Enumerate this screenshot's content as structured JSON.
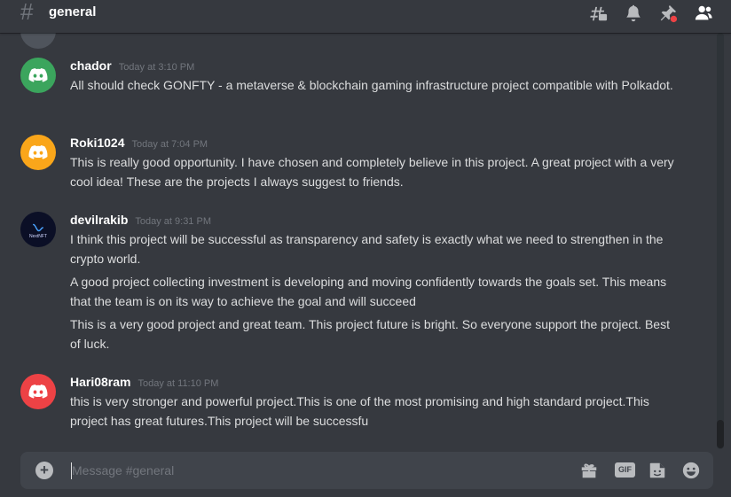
{
  "channel": {
    "hash": "#",
    "name": "general"
  },
  "header_icons": [
    "threads-icon",
    "bell-icon",
    "pin-icon",
    "member-list-icon"
  ],
  "colors": {
    "background": "#36393f",
    "composer": "#40444b",
    "unread_dot": "#ed4245"
  },
  "messages": [
    {
      "username": "chador",
      "timestamp": "Today at 3:10 PM",
      "avatar_color": "#3ba55d",
      "avatar_icon": "discord-logo-icon",
      "lines": [
        "All should check GONFTY - a metaverse & blockchain gaming infrastructure project compatible with Polkadot."
      ]
    },
    {
      "username": "Roki1024",
      "timestamp": "Today at 7:04 PM",
      "avatar_color": "#faa61a",
      "avatar_icon": "discord-logo-icon",
      "lines": [
        "This is really good opportunity. I have chosen and completely believe in this project. A great project with a very cool idea! These are the projects I always suggest to friends."
      ]
    },
    {
      "username": "devilrakib",
      "timestamp": "Today at 9:31 PM",
      "avatar_color": "#0b0f26",
      "avatar_icon": "nextnft-logo-icon",
      "avatar_text": "NextNFT",
      "lines": [
        "I think this project will be successful as transparency and safety is exactly what we need to strengthen in the crypto world.",
        "A good project collecting investment is developing and moving confidently towards the goals set. This means that the team is on its way to achieve the goal and will succeed",
        "This is a very good project and great team. This project future is bright. So everyone support the project. Best of luck."
      ]
    },
    {
      "username": "Hari08ram",
      "timestamp": "Today at 11:10 PM",
      "avatar_color": "#ed4245",
      "avatar_icon": "discord-logo-icon",
      "lines": [
        "this is very stronger and powerful project.This is one of the most promising and high standard project.This project has great futures.This project will be successfu"
      ]
    }
  ],
  "composer": {
    "placeholder": "Message #general",
    "gif_label": "GIF",
    "icons": [
      "add-attachment-icon",
      "gift-icon",
      "gif-icon",
      "sticker-icon",
      "emoji-icon"
    ]
  }
}
